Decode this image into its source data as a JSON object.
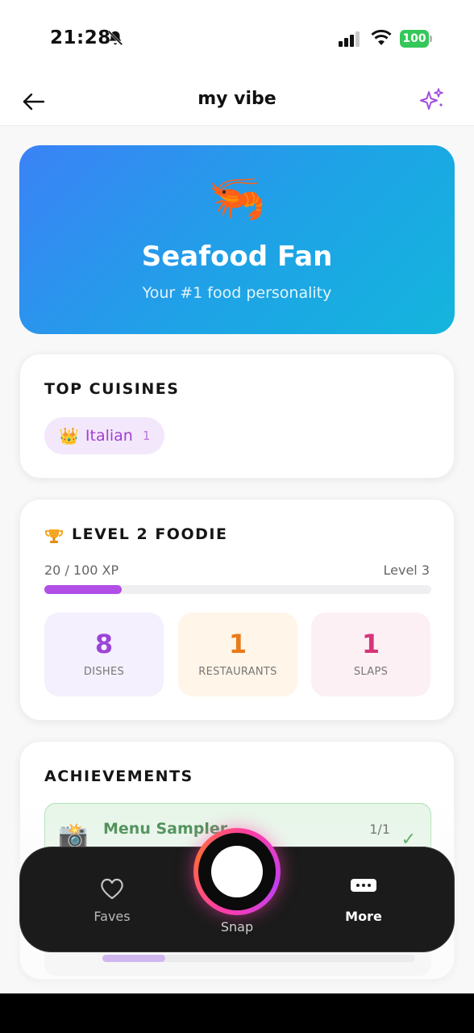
{
  "status_bar": {
    "time": "21:28",
    "battery": "100",
    "icons": [
      "bell-slash-icon",
      "signal-icon",
      "wifi-icon",
      "battery-icon"
    ]
  },
  "nav": {
    "title": "my vibe",
    "back_icon": "arrow-left-icon",
    "action_icon": "sparkles-icon"
  },
  "hero": {
    "emoji": "🦐",
    "title": "Seafood Fan",
    "subtitle": "Your #1 food personality"
  },
  "cuisines": {
    "title": "TOP CUISINES",
    "items": [
      {
        "emoji": "👑",
        "name": "Italian",
        "count": "1"
      }
    ]
  },
  "level": {
    "title": "LEVEL 2 FOODIE",
    "xp_text": "20 / 100 XP",
    "next_level": "Level 3",
    "xp_progress": 0.2,
    "stats": [
      {
        "value": "8",
        "label": "DISHES"
      },
      {
        "value": "1",
        "label": "RESTAURANTS"
      },
      {
        "value": "1",
        "label": "SLAPS"
      }
    ]
  },
  "achievements": {
    "title": "ACHIEVEMENTS",
    "items": [
      {
        "icon": "📸",
        "name": "Menu Sampler",
        "progress": "1/1",
        "completed": true
      },
      {
        "progress_fraction": 0.2
      }
    ]
  },
  "tabbar": {
    "faves": "Faves",
    "snap": "Snap",
    "more": "More"
  },
  "colors": {
    "accent": "#b14ee6",
    "hero_gradient_start": "#3b82f6",
    "hero_gradient_end": "#14b5dd",
    "tabbar_bg": "#1b1b1b"
  }
}
